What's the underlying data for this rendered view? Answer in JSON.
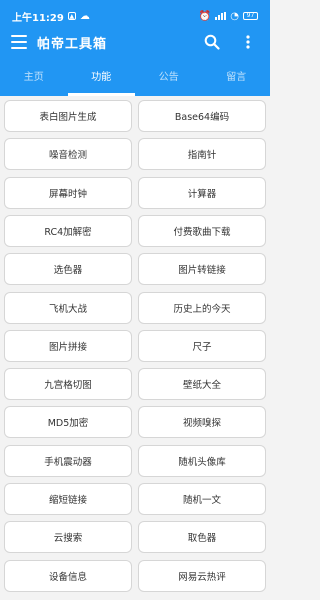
{
  "status_bar": {
    "time": "上午11:29",
    "battery": "97"
  },
  "toolbar": {
    "title": "帕帝工具箱"
  },
  "tabs": [
    {
      "label": "主页"
    },
    {
      "label": "功能"
    },
    {
      "label": "公告"
    },
    {
      "label": "留言"
    }
  ],
  "active_tab": "功能",
  "tools": [
    "表白图片生成",
    "Base64编码",
    "噪音检测",
    "指南针",
    "屏幕时钟",
    "计算器",
    "RC4加解密",
    "付费歌曲下载",
    "选色器",
    "图片转链接",
    "飞机大战",
    "历史上的今天",
    "图片拼接",
    "尺子",
    "九宫格切图",
    "壁纸大全",
    "MD5加密",
    "视频嗅探",
    "手机震动器",
    "随机头像库",
    "缩短链接",
    "随机一文",
    "云搜索",
    "取色器",
    "设备信息",
    "网易云热评"
  ],
  "colors": {
    "primary": "#2196f3",
    "background": "#f3f3f3",
    "card": "#ffffff"
  }
}
